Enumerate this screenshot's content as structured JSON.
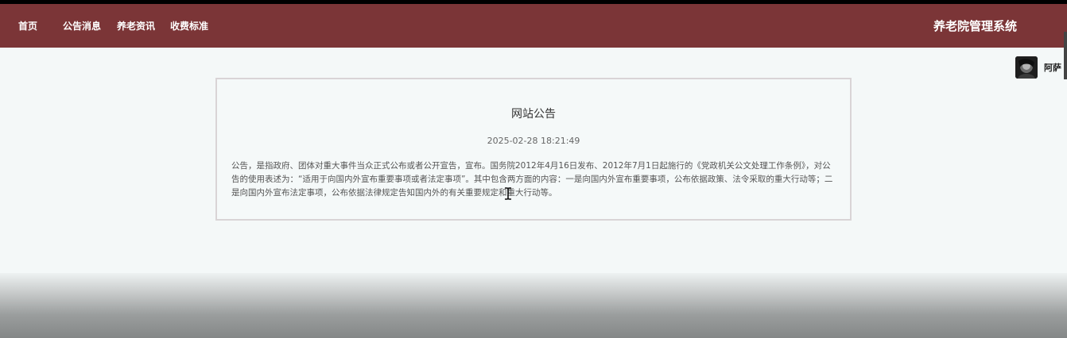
{
  "nav": {
    "items": [
      {
        "label": "首页"
      },
      {
        "label": "公告消息"
      },
      {
        "label": "养老资讯"
      },
      {
        "label": "收费标准"
      }
    ],
    "brand": "养老院管理系统"
  },
  "user": {
    "name": "阿萨",
    "avatar_icon": "user-avatar"
  },
  "notice": {
    "title": "网站公告",
    "time": "2025-02-28 18:21:49",
    "content": "公告，是指政府、团体对重大事件当众正式公布或者公开宣告，宣布。国务院2012年4月16日发布、2012年7月1日起施行的《党政机关公文处理工作条例》，对公告的使用表述为：“适用于向国内外宣布重要事项或者法定事项”。其中包含两方面的内容：一是向国内外宣布重要事项，公布依据政策、法令采取的重大行动等；二是向国内外宣布法定事项，公布依据法律规定告知国内外的有关重要规定和重大行动等。"
  },
  "colors": {
    "navbar": "#7b3537",
    "background": "#f4f8f8",
    "card_border": "#d9d4d6"
  }
}
